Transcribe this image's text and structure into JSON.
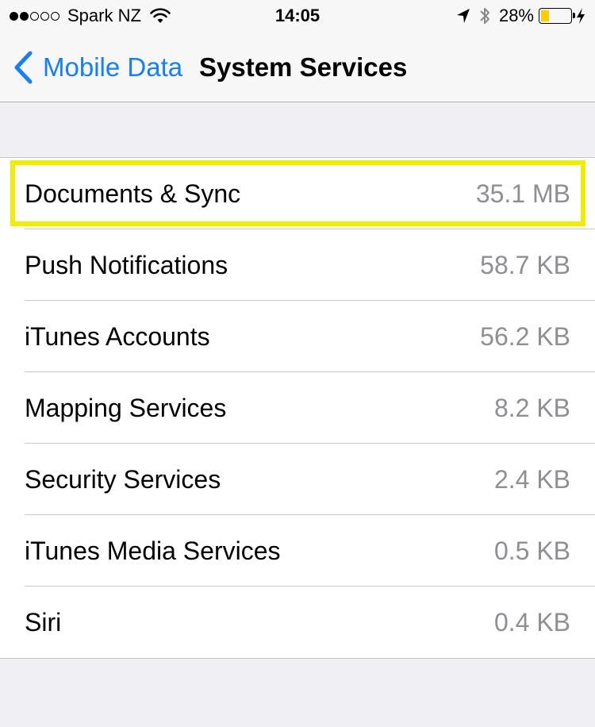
{
  "status_bar": {
    "carrier": "Spark NZ",
    "signal_bars_filled": 2,
    "signal_bars_total": 5,
    "time": "14:05",
    "battery_percent": "28%",
    "battery_level": 0.28,
    "battery_color": "#ffcc00"
  },
  "nav": {
    "back_label": "Mobile Data",
    "title": "System Services"
  },
  "colors": {
    "accent": "#157efb",
    "highlight": "#f2ec00",
    "secondary_text": "#8e8e93"
  },
  "services": [
    {
      "label": "Documents & Sync",
      "value": "35.1 MB",
      "highlighted": true
    },
    {
      "label": "Push Notifications",
      "value": "58.7 KB"
    },
    {
      "label": "iTunes Accounts",
      "value": "56.2 KB"
    },
    {
      "label": "Mapping Services",
      "value": "8.2 KB"
    },
    {
      "label": "Security Services",
      "value": "2.4 KB"
    },
    {
      "label": "iTunes Media Services",
      "value": "0.5 KB"
    },
    {
      "label": "Siri",
      "value": "0.4 KB"
    }
  ]
}
